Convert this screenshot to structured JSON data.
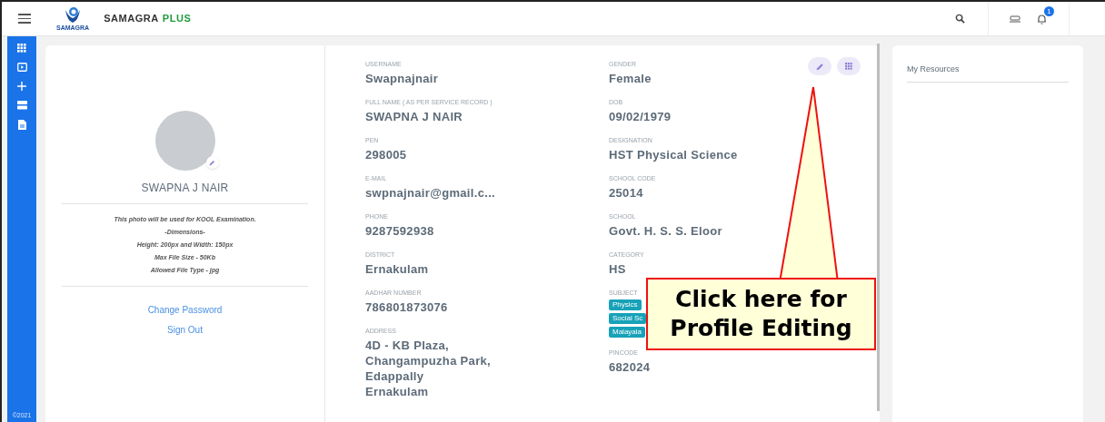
{
  "header": {
    "logo_caption": "SAMAGRA",
    "brand_main": "SAMAGRA",
    "brand_accent": "PLUS",
    "notification_count": "1"
  },
  "sidebar": {
    "footer": "©2021"
  },
  "profile": {
    "name": "SWAPNA J NAIR",
    "photo_note": [
      "This photo will be used for KOOL Examination.",
      "-Dimensions-",
      "Height: 200px and Width: 150px",
      "Max File Size - 50Kb",
      "Allowed File Type - jpg"
    ],
    "links": [
      "Change Password",
      "Sign Out"
    ]
  },
  "fields_left": [
    {
      "kind": "text",
      "label": "USERNAME",
      "value": "Swapnajnair"
    },
    {
      "kind": "text",
      "label": "FULL NAME ( AS PER SERVICE RECORD )",
      "value": "SWAPNA J NAIR"
    },
    {
      "kind": "text",
      "label": "PEN",
      "value": "298005"
    },
    {
      "kind": "text",
      "label": "E-MAIL",
      "value": "swpnajnair@gmail.c..."
    },
    {
      "kind": "text",
      "label": "PHONE",
      "value": "9287592938"
    },
    {
      "kind": "text",
      "label": "DISTRICT",
      "value": "Ernakulam"
    },
    {
      "kind": "text",
      "label": "AADHAR NUMBER",
      "value": "786801873076"
    },
    {
      "kind": "lines",
      "label": "ADDRESS",
      "lines": [
        "4D - KB Plaza,",
        "Changampuzha Park,",
        "Edappally",
        "Ernakulam"
      ]
    }
  ],
  "fields_right": [
    {
      "kind": "text",
      "label": "GENDER",
      "value": "Female"
    },
    {
      "kind": "text",
      "label": "DOB",
      "value": "09/02/1979"
    },
    {
      "kind": "text",
      "label": "DESIGNATION",
      "value": "HST Physical Science"
    },
    {
      "kind": "text",
      "label": "SCHOOL CODE",
      "value": "25014"
    },
    {
      "kind": "text",
      "label": "SCHOOL",
      "value": "Govt. H. S. S. Eloor"
    },
    {
      "kind": "text",
      "label": "CATEGORY",
      "value": "HS"
    },
    {
      "kind": "chips",
      "label": "SUBJECT",
      "chips": [
        "Physics",
        "Social Sc",
        "Malayala"
      ]
    },
    {
      "kind": "text",
      "label": "PINCODE",
      "value": "682024"
    }
  ],
  "resources": {
    "title": "My Resources"
  },
  "callout": {
    "text": "Click here for Profile Editing"
  }
}
